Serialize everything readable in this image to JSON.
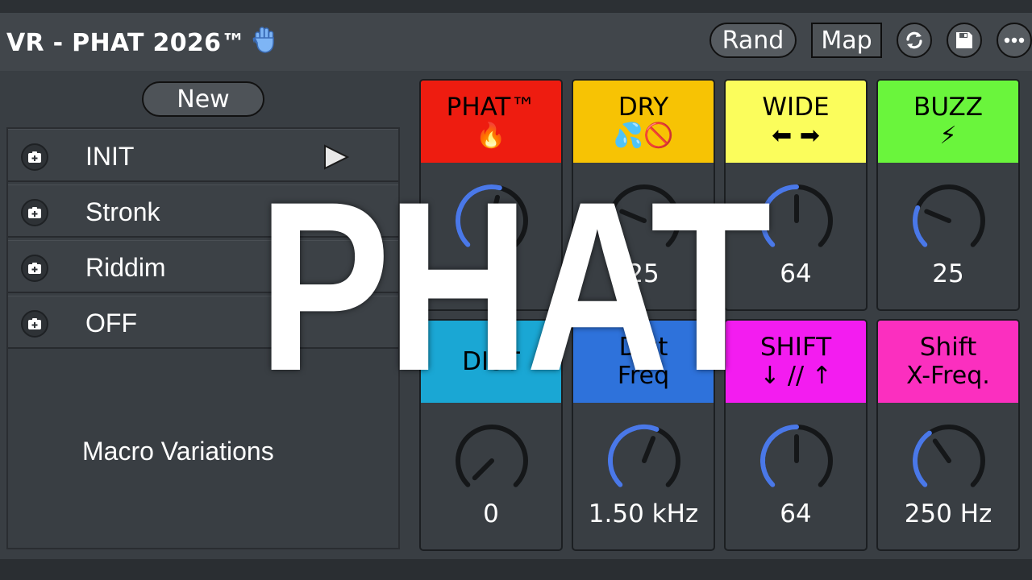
{
  "header": {
    "title": "VR - PHAT 2026™",
    "hand_icon": "raised-hand-icon",
    "rand_label": "Rand",
    "map_label": "Map",
    "icons": [
      "refresh-icon",
      "save-icon",
      "more-icon"
    ]
  },
  "presets": {
    "new_label": "New",
    "items": [
      {
        "label": "INIT",
        "icon": "preset-icon",
        "playing": true
      },
      {
        "label": "Stronk",
        "icon": "preset-icon"
      },
      {
        "label": "Riddim",
        "icon": "preset-icon"
      },
      {
        "label": "OFF",
        "icon": "preset-icon"
      }
    ],
    "footer_label": "Macro Variations"
  },
  "macros": [
    {
      "title": "PHAT™",
      "sub": "🔥",
      "color": "#ee1c10",
      "value": "",
      "level": 0.55
    },
    {
      "title": "DRY",
      "sub": "💦🚫",
      "color": "#f7c304",
      "value": "25",
      "level": 0.25
    },
    {
      "title": "WIDE",
      "sub": "⬅ ➡",
      "color": "#fbfd5c",
      "value": "64",
      "level": 0.5
    },
    {
      "title": "BUZZ",
      "sub": "⚡",
      "color": "#6af53c",
      "value": "25",
      "level": 0.25
    },
    {
      "title": "DIST",
      "sub": "",
      "color": "#1aa7d4",
      "value": "0",
      "level": 0.0
    },
    {
      "title": "Dist",
      "sub": "Freq",
      "color": "#2e72db",
      "value": "1.50 kHz",
      "level": 0.58
    },
    {
      "title": "SHIFT",
      "sub": "↓ // ↑",
      "color": "#f31cf0",
      "value": "64",
      "level": 0.5
    },
    {
      "title": "Shift",
      "sub": "X-Freq.",
      "color": "#fb2fbf",
      "value": "250 Hz",
      "level": 0.37
    }
  ],
  "overlay_text": "PHAT",
  "colors": {
    "accent_arc": "#4a78e8",
    "knob_track": "#151719",
    "panel_bg": "#393e43"
  }
}
